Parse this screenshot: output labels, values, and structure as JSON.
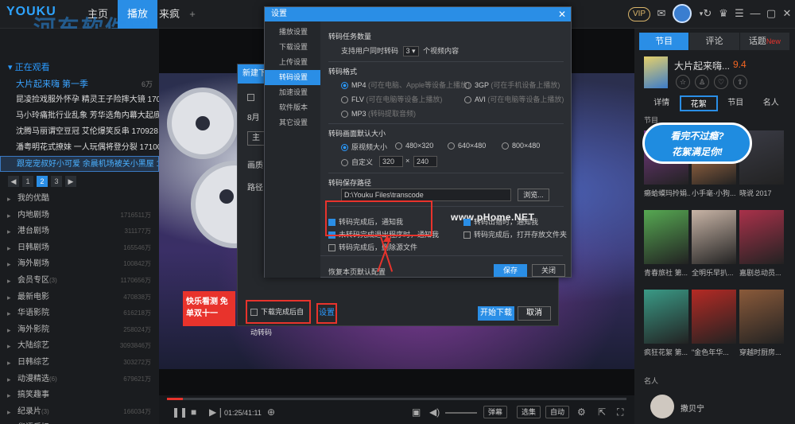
{
  "topbar": {
    "logo": "YOUKU",
    "tabs": [
      {
        "label": "主页"
      },
      {
        "label": "播放"
      },
      {
        "label": "来疯"
      }
    ],
    "add_label": "+",
    "watermark": "河东软件园",
    "watermark_url": "www.pc0359.cn",
    "vip": "VIP"
  },
  "sidebar": {
    "now_watching": "正在观看",
    "current_show": "大片起来嗨 第一季",
    "current_count": "6万",
    "episodes": [
      "昆凌捡戏服外怀孕 精灵王子险摔大镜 170...",
      "马小玲痛批行业乱象 芳华选角内幕大起底...",
      "沈腾马丽谓空豆冠 艾伦爆笑反串 170928",
      "潘粤明花式撩妹 一人玩偶将登分裂 171005",
      "跟宠宠叔好小可爱 余晨机场被关小黑屋 17..."
    ],
    "pages": [
      "1",
      "2",
      "3"
    ],
    "categories": [
      {
        "name": "我的优酷",
        "count": ""
      },
      {
        "name": "内地剧场",
        "count": "1716511万"
      },
      {
        "name": "港台剧场",
        "count": "311177万"
      },
      {
        "name": "日韩剧场",
        "count": "165546万"
      },
      {
        "name": "海外剧场",
        "count": "100842万"
      },
      {
        "name": "会员专区",
        "sub": "(3)",
        "count": "1170656万"
      },
      {
        "name": "最新电影",
        "count": "470838万"
      },
      {
        "name": "华语影院",
        "count": "616218万"
      },
      {
        "name": "海外影院",
        "count": "258024万"
      },
      {
        "name": "大陆综艺",
        "count": "3093846万"
      },
      {
        "name": "日韩综艺",
        "count": "303272万"
      },
      {
        "name": "动漫精选",
        "sub": "(6)",
        "count": "679621万"
      },
      {
        "name": "搞笑趣事",
        "count": ""
      },
      {
        "name": "纪录片",
        "sub": "(3)",
        "count": "166034万"
      },
      {
        "name": "华语乐坛",
        "count": "14663万"
      }
    ]
  },
  "player": {
    "time": "01:25/41:11",
    "progress": 0.034,
    "danmu": "弹幕",
    "select": "选集",
    "auto": "自动",
    "promo": "快乐看测 免单双十一"
  },
  "download_dialog": {
    "title": "新建下载",
    "date_label": "8月",
    "main_btn": "主",
    "quality_label": "画质：",
    "path_label": "路径：",
    "auto_transcode": "下载完成后自动转码",
    "settings_link": "设置",
    "start_btn": "开始下载",
    "cancel_btn": "取消"
  },
  "settings": {
    "title": "设置",
    "close": "✕",
    "nav": [
      "播放设置",
      "下载设置",
      "上传设置",
      "转码设置",
      "加速设置",
      "软件版本",
      "其它设置"
    ],
    "task_title": "转码任务数量",
    "task_prefix": "支持用户同时转码",
    "task_value": "3",
    "task_suffix": "个视频内容",
    "format_title": "转码格式",
    "formats": [
      {
        "label": "MP4",
        "hint": "(可在电脑、Apple等设备上播放)",
        "checked": true
      },
      {
        "label": "3GP",
        "hint": "(可在手机设备上播放)",
        "checked": false
      },
      {
        "label": "FLV",
        "hint": "(可在电脑等设备上播放)",
        "checked": false
      },
      {
        "label": "AVI",
        "hint": "(可在电脑等设备上播放)",
        "checked": false
      },
      {
        "label": "MP3",
        "hint": "(转码提取音频)",
        "checked": false
      }
    ],
    "size_title": "转码画面默认大小",
    "sizes": [
      "原视频大小",
      "480×320",
      "640×480",
      "800×480"
    ],
    "custom_label": "自定义",
    "custom_w": "320",
    "custom_h": "240",
    "times": "×",
    "path_title": "转码保存路径",
    "path_value": "D:\\Youku Files\\transcode",
    "browse": "浏览...",
    "options": [
      {
        "label": "转码完成后，通知我",
        "checked": true
      },
      {
        "label": "转码出错时，通知我",
        "checked": true
      },
      {
        "label": "未转码完成退出程序时，通知我",
        "checked": true
      },
      {
        "label": "转码完成后，打开存放文件夹",
        "checked": false
      },
      {
        "label": "转码完成后，删除源文件",
        "checked": false
      }
    ],
    "restore": "恢复本页默认配置",
    "save": "保存",
    "close_btn": "关闭",
    "watermark": "www.pHome.NET"
  },
  "rpanel": {
    "tabs": [
      "节目",
      "评论",
      "话题"
    ],
    "topic_badge": "New",
    "show_title": "大片起来嗨...",
    "rating": "9.4",
    "subtabs": [
      "详情",
      "花絮",
      "节目",
      "名人"
    ],
    "section_program": "节目",
    "bubble_line1": "看完不过瘾?",
    "bubble_line2": "花絮满足你!",
    "thumbs": [
      {
        "caption": "癞蛤蟆玛拎娟...",
        "color": "#7a3a86"
      },
      {
        "caption": "小手毫·小狗...",
        "color": "#d98a52"
      },
      {
        "caption": "晓说 2017",
        "color": "#3a3b45"
      },
      {
        "caption": "青春旅社 第...",
        "color": "#56a852"
      },
      {
        "caption": "全明乐早扒...",
        "color": "#c8b4a6"
      },
      {
        "caption": "嘉剧总动员...",
        "color": "#a9314a"
      },
      {
        "caption": "疯狂花絮 第...",
        "color": "#3a9a86"
      },
      {
        "caption": "\"金色年华...",
        "color": "#b52a24"
      },
      {
        "caption": "穿越时厨房...",
        "color": "#8a5a3a"
      }
    ],
    "section_people": "名人",
    "person_name": "撒贝宁"
  }
}
